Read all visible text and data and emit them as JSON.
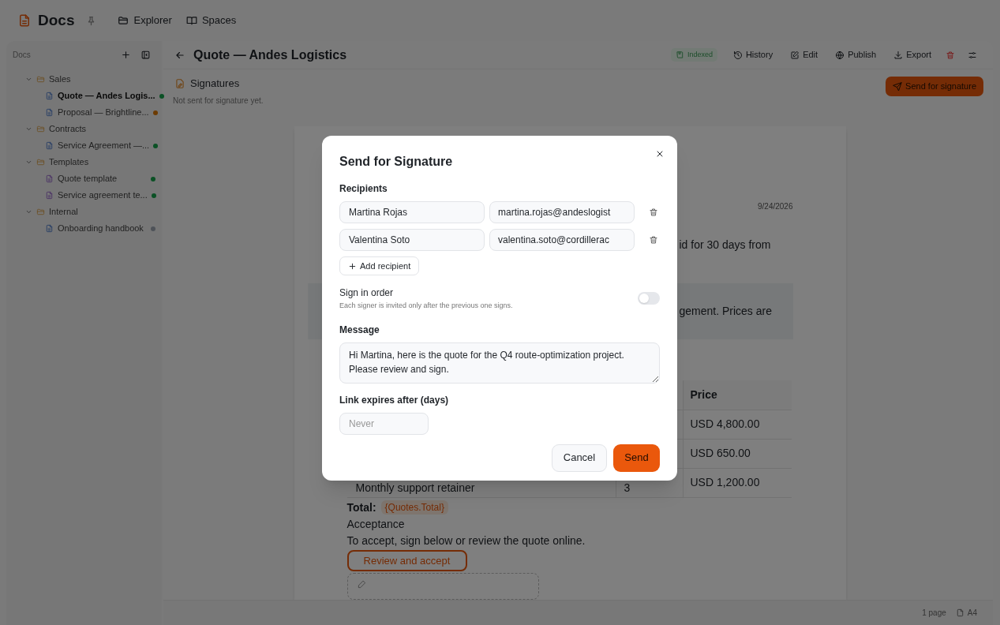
{
  "app": {
    "name": "Docs",
    "nav": [
      {
        "label": "Explorer"
      },
      {
        "label": "Spaces"
      }
    ]
  },
  "sidebar": {
    "title": "Docs",
    "tree": [
      {
        "label": "Sales",
        "expanded": true,
        "children": [
          {
            "label": "Quote — Andes Logis...",
            "kind": "document",
            "selected": true,
            "color": "#0b5125"
          },
          {
            "label": "Proposal — Brightline...",
            "kind": "document",
            "selected": false,
            "color": "#6c3b03"
          }
        ]
      },
      {
        "label": "Contracts",
        "expanded": true,
        "children": [
          {
            "label": "Service Agreement —...",
            "kind": "document",
            "selected": false,
            "color": "#0b5125"
          }
        ]
      },
      {
        "label": "Templates",
        "expanded": true,
        "children": [
          {
            "label": "Quote template",
            "kind": "template",
            "selected": false,
            "color": "#0b5125"
          },
          {
            "label": "Service agreement te...",
            "kind": "template",
            "selected": false,
            "color": "#0b5125"
          }
        ]
      },
      {
        "label": "Internal",
        "expanded": true,
        "children": [
          {
            "label": "Onboarding handbook",
            "kind": "document",
            "selected": false,
            "color": "#4e5258"
          }
        ]
      }
    ]
  },
  "header": {
    "title": "Quote — Andes Logistics",
    "badge": "Indexed",
    "actions": [
      {
        "kind": "history",
        "label": "History"
      },
      {
        "kind": "edit",
        "label": "Edit"
      },
      {
        "kind": "publish",
        "label": "Publish"
      },
      {
        "kind": "export",
        "label": "Export"
      },
      {
        "kind": "delete"
      },
      {
        "kind": "settings"
      }
    ]
  },
  "signatures": {
    "title": "Signatures",
    "status": "Not sent for signature yet.",
    "button": "Send for signature"
  },
  "document": {
    "date": "9/24/2026",
    "fragment_1": "id for 30 days from",
    "fragment_2": "gement. Prices are",
    "table": {
      "columns": [
        "Price"
      ],
      "rows": [
        {
          "price": "USD 4,800.00"
        },
        {
          "price": "USD 650.00"
        },
        {
          "item": "Monthly support retainer",
          "qty": "3",
          "price": "USD 1,200.00"
        }
      ]
    },
    "total_label": "Total:",
    "total_value": "{Quotes.Total}",
    "heading": "Acceptance",
    "sentence": "To accept, sign below or review the quote online.",
    "button": "Review and accept"
  },
  "modal": {
    "title": "Send for Signature",
    "recipients_label": "Recipients",
    "recipients": [
      {
        "name": "Martina Rojas",
        "email": "martina.rojas@andeslogist"
      },
      {
        "name": "Valentina Soto",
        "email": "valentina.soto@cordillerac"
      }
    ],
    "add_button": "Add recipient",
    "sign_in_order": {
      "label": "Sign in order",
      "hint": "Each signer is invited only after the previous one signs.",
      "on": false
    },
    "message": {
      "label": "Message",
      "value": "Hi Martina, here is the quote for the Q4 route-optimization project. Please review and sign."
    },
    "expires": {
      "label": "Link expires after (days)",
      "placeholder": "Never"
    },
    "buttons": [
      {
        "kind": "secondary",
        "label": "Cancel"
      },
      {
        "kind": "primary",
        "label": "Send"
      }
    ]
  },
  "footer": {
    "pages": "1 page",
    "size": "A4"
  }
}
